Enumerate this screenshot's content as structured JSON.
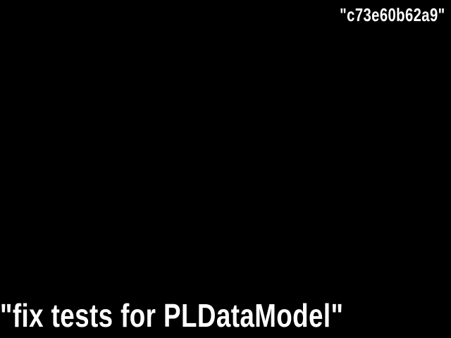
{
  "commit": {
    "hash": "\"c73e60b62a9\"",
    "message": "\"fix tests for PLDataModel\""
  },
  "colors": {
    "background": "#000000",
    "text": "#ffffff"
  }
}
